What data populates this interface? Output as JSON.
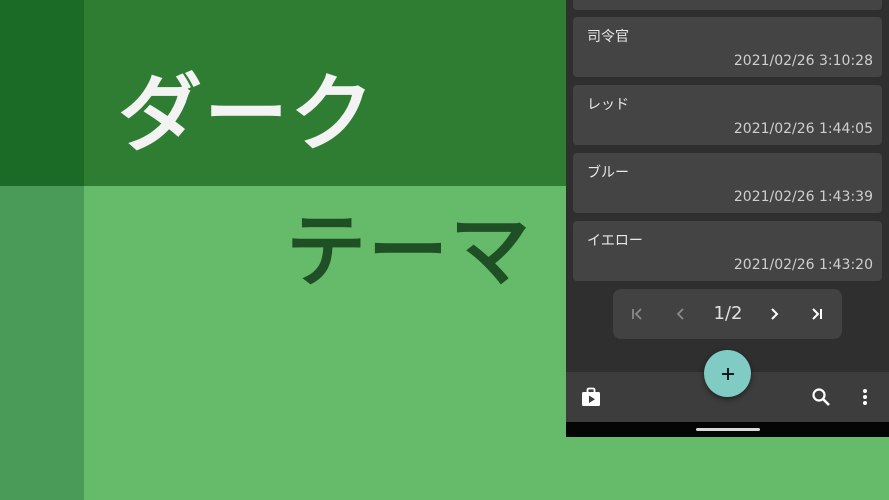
{
  "banner": {
    "title_line1": "ダーク",
    "title_line2": "テーマ",
    "colors": {
      "dark_green": "#2e7d32",
      "darker_green": "#1b6a26",
      "light_green": "#66bb6a",
      "mid_green": "#4a9a58",
      "title_light": "#f3f3f3",
      "title_dark": "#1f4f25"
    }
  },
  "app": {
    "list": [
      {
        "name": "司令官",
        "time": "2021/02/26 3:10:28"
      },
      {
        "name": "レッド",
        "time": "2021/02/26 1:44:05"
      },
      {
        "name": "ブルー",
        "time": "2021/02/26 1:43:39"
      },
      {
        "name": "イエロー",
        "time": "2021/02/26 1:43:20"
      }
    ],
    "pagination": {
      "page_label": "1/2",
      "first_icon": "first-page-icon",
      "prev_icon": "chevron-left-icon",
      "next_icon": "chevron-right-icon",
      "last_icon": "last-page-icon"
    },
    "fab_icon": "plus-icon",
    "bottom_bar": {
      "left_icon": "play-store-bag-icon",
      "search_icon": "search-icon",
      "menu_icon": "more-vertical-icon"
    },
    "colors": {
      "background": "#2f2f2f",
      "card": "#444444",
      "fab": "#80cbc4"
    }
  }
}
